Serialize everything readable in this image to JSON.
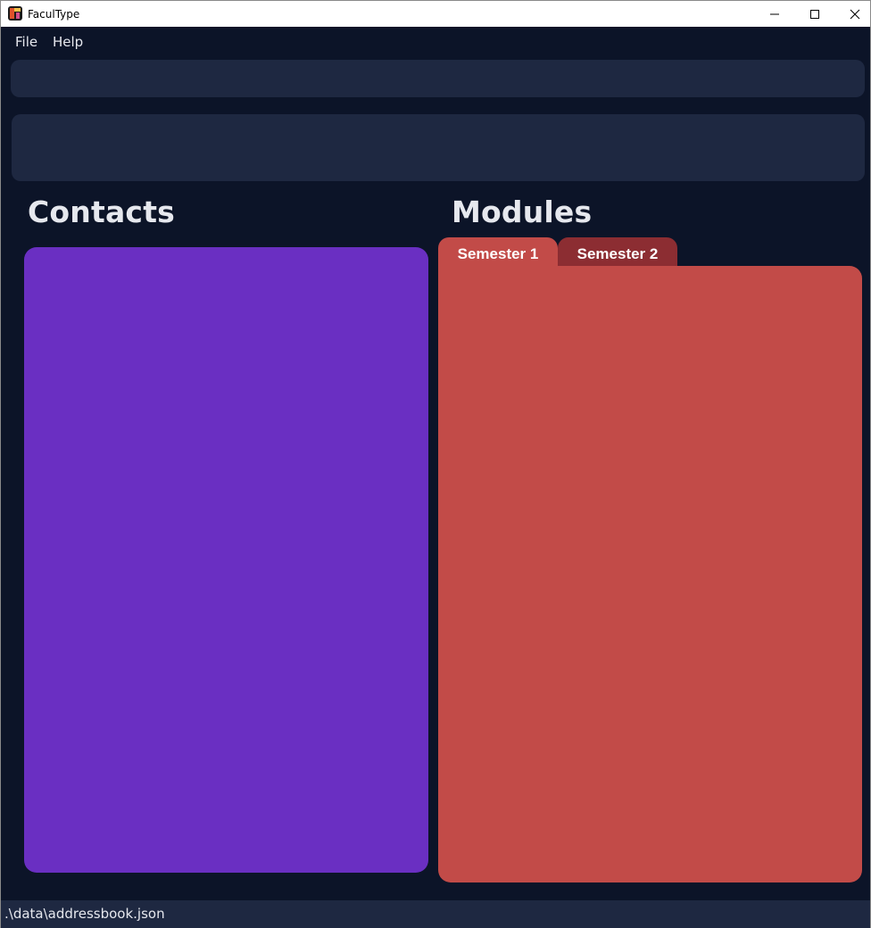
{
  "window": {
    "title": "FaculType",
    "icon": "faculType-app-icon"
  },
  "menu": {
    "file_label": "File",
    "help_label": "Help"
  },
  "command": {
    "value": "",
    "placeholder": ""
  },
  "result": {
    "text": ""
  },
  "contacts": {
    "title": "Contacts",
    "panel_color": "#6a2fc2"
  },
  "modules": {
    "title": "Modules",
    "tabs": [
      {
        "label": "Semester 1",
        "selected": true,
        "color": "#c24b48"
      },
      {
        "label": "Semester 2",
        "selected": false,
        "color": "#8c2d32"
      }
    ],
    "panel_color": "#c24b48"
  },
  "status": {
    "save_path": ".\\data\\addressbook.json"
  },
  "colors": {
    "background": "#0c1428",
    "box": "#1e2841",
    "text": "#e6e8ee"
  }
}
